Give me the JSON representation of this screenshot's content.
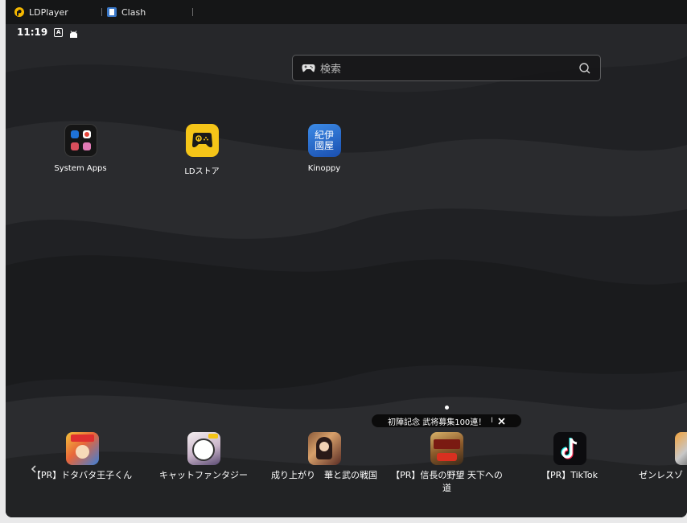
{
  "tabs": [
    {
      "label": "LDPlayer",
      "icon": "ldplayer-logo-icon"
    },
    {
      "label": "Clash",
      "icon": "clash-app-icon"
    }
  ],
  "status_bar": {
    "time": "11:19",
    "icons": [
      "a-badge-icon",
      "android-icon"
    ]
  },
  "search": {
    "placeholder": "検索",
    "left_icon": "gamepad-icon",
    "right_icon": "search-icon"
  },
  "apps": [
    {
      "label": "System Apps",
      "icon": "folder-icon"
    },
    {
      "label": "LDストア",
      "icon": "ld-store-icon"
    },
    {
      "label": "Kinoppy",
      "icon": "kinoppy-icon",
      "icon_text": "紀伊國屋"
    }
  ],
  "banner": {
    "text": "初陣記念 武将募集100連！",
    "sep": "I"
  },
  "dock": [
    {
      "label": "【PR】ドタバタ王子くん",
      "icon": "game-icon"
    },
    {
      "label": "キャットファンタジー",
      "icon": "game-icon"
    },
    {
      "label": "成り上がり　華と武の戦国",
      "icon": "game-icon"
    },
    {
      "label": "【PR】信長の野望 天下への",
      "label2": "道",
      "icon": "game-icon"
    },
    {
      "label": "【PR】TikTok",
      "icon": "tiktok-icon"
    },
    {
      "label": "ゼンレスゾ",
      "icon": "game-icon"
    }
  ],
  "colors": {
    "ld_yellow": "#f5c518",
    "kinoppy_blue": "#1f6fd1",
    "background": "#1e1f21"
  }
}
